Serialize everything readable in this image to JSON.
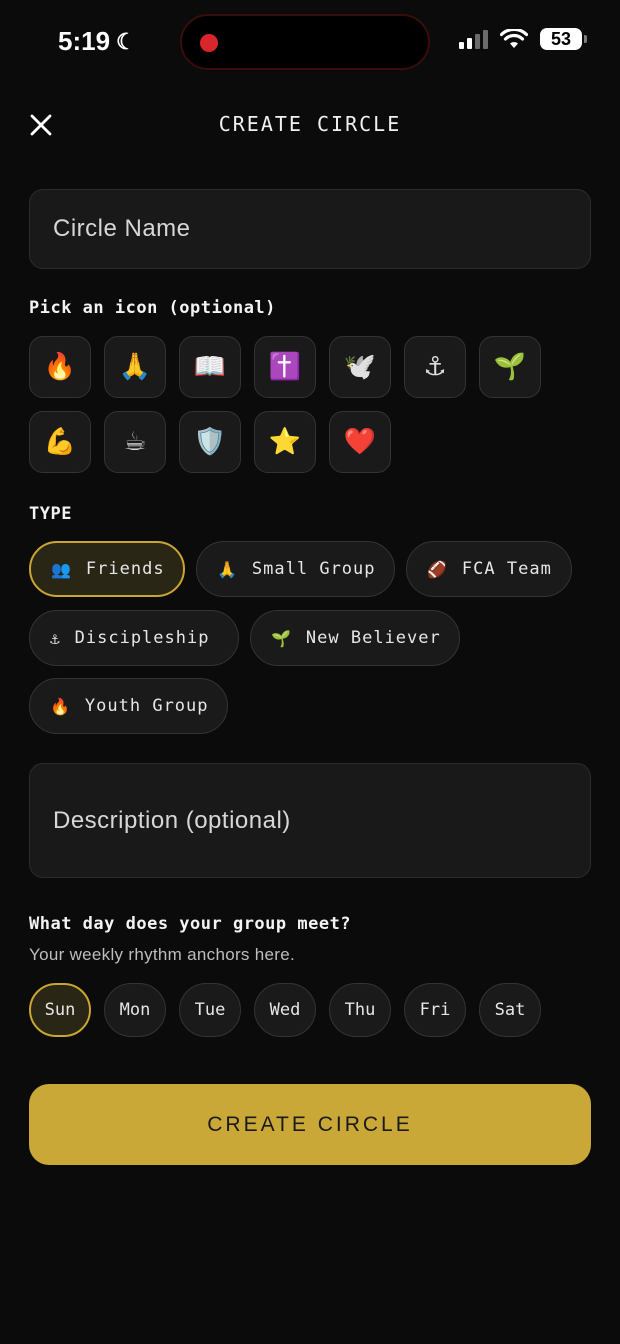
{
  "status_bar": {
    "time": "5:19",
    "battery": "53"
  },
  "header": {
    "title": "CREATE CIRCLE"
  },
  "form": {
    "name_placeholder": "Circle Name",
    "icon_label": "Pick an icon (optional)",
    "icons": [
      "🔥",
      "🙏",
      "📖",
      "✝️",
      "🕊️",
      "⚓",
      "🌱",
      "💪",
      "☕",
      "🛡️",
      "⭐",
      "❤️"
    ],
    "type_label": "TYPE",
    "types": [
      {
        "emoji": "👥",
        "label": "Friends",
        "selected": true
      },
      {
        "emoji": "🙏",
        "label": "Small Group",
        "selected": false
      },
      {
        "emoji": "🏈",
        "label": "FCA Team",
        "selected": false
      },
      {
        "emoji": "⚓",
        "label": "Discipleship",
        "selected": false
      },
      {
        "emoji": "🌱",
        "label": "New Believer",
        "selected": false
      },
      {
        "emoji": "🔥",
        "label": "Youth Group",
        "selected": false
      }
    ],
    "description_placeholder": "Description (optional)",
    "meet_label": "What day does your group meet?",
    "meet_subtitle": "Your weekly rhythm anchors here.",
    "days": [
      "Sun",
      "Mon",
      "Tue",
      "Wed",
      "Thu",
      "Fri",
      "Sat"
    ],
    "selected_day": "Sun",
    "submit_label": "CREATE CIRCLE"
  },
  "colors": {
    "accent": "#c9a838",
    "background": "#0b0b0b",
    "surface": "#1a1a1a"
  }
}
